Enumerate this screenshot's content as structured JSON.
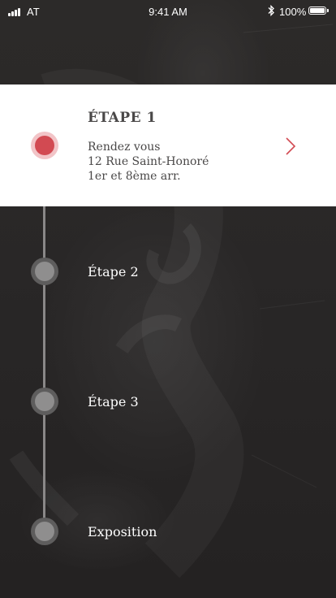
{
  "status_bar": {
    "carrier": "AT",
    "time": "9:41 AM",
    "battery": "100%"
  },
  "timeline": {
    "active_step": {
      "title": "ÉTAPE 1",
      "lines": [
        "Rendez vous",
        "12 Rue Saint-Honoré",
        "1er et 8ème arr."
      ]
    },
    "steps": [
      {
        "label": "Étape 2"
      },
      {
        "label": "Étape 3"
      },
      {
        "label": "Exposition"
      }
    ]
  },
  "colors": {
    "accent": "#d24a52",
    "card": "#ffffff",
    "background": "#2a2828",
    "inactive_dot": "#8f8e8e"
  }
}
